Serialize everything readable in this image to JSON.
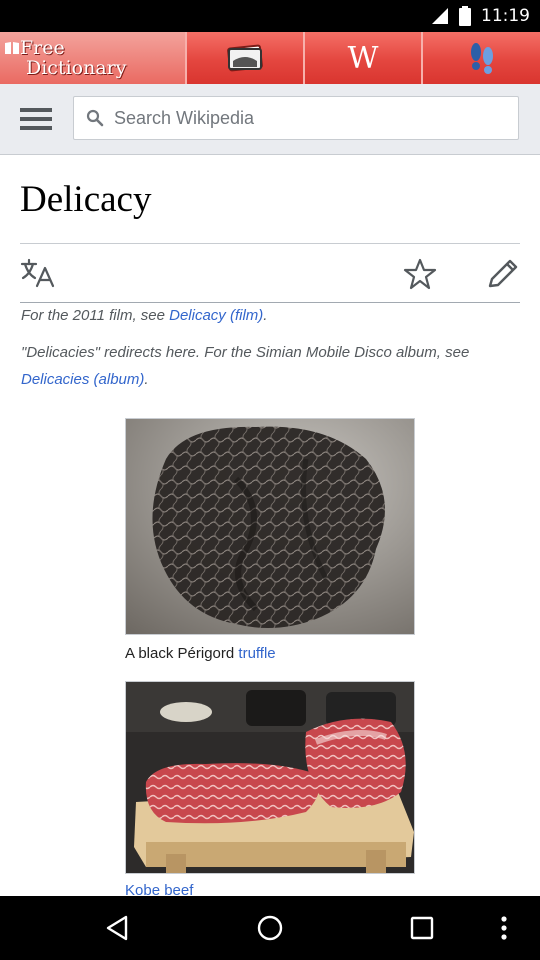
{
  "status_bar": {
    "time": "11:19",
    "icons": [
      "signal-icon",
      "battery-icon"
    ]
  },
  "app_toolbar": {
    "logo_line1": "Free",
    "logo_line2": "Dictionary",
    "tabs": [
      "flashcards-icon",
      "wikipedia-w-icon",
      "footprints-icon"
    ],
    "wiki_glyph": "W",
    "accent": "#e4463f"
  },
  "wiki_header": {
    "search_placeholder": "Search Wikipedia"
  },
  "article": {
    "title": "Delicacy",
    "hatnote1": {
      "prefix": "For the 2011 film, see ",
      "link": "Delicacy (film)",
      "suffix": "."
    },
    "hatnote2": {
      "prefix": "\"Delicacies\" redirects here. For the Simian Mobile Disco album, see ",
      "link": "Delicacies (album)",
      "suffix": "."
    },
    "images": [
      {
        "caption_prefix": "A black Périgord ",
        "caption_link": "truffle"
      },
      {
        "caption_prefix": "",
        "caption_link": "Kobe beef"
      }
    ],
    "link_color": "#3366cc"
  },
  "nav_bar": {
    "buttons": [
      "back-icon",
      "home-icon",
      "recents-icon",
      "overflow-menu-icon"
    ]
  }
}
